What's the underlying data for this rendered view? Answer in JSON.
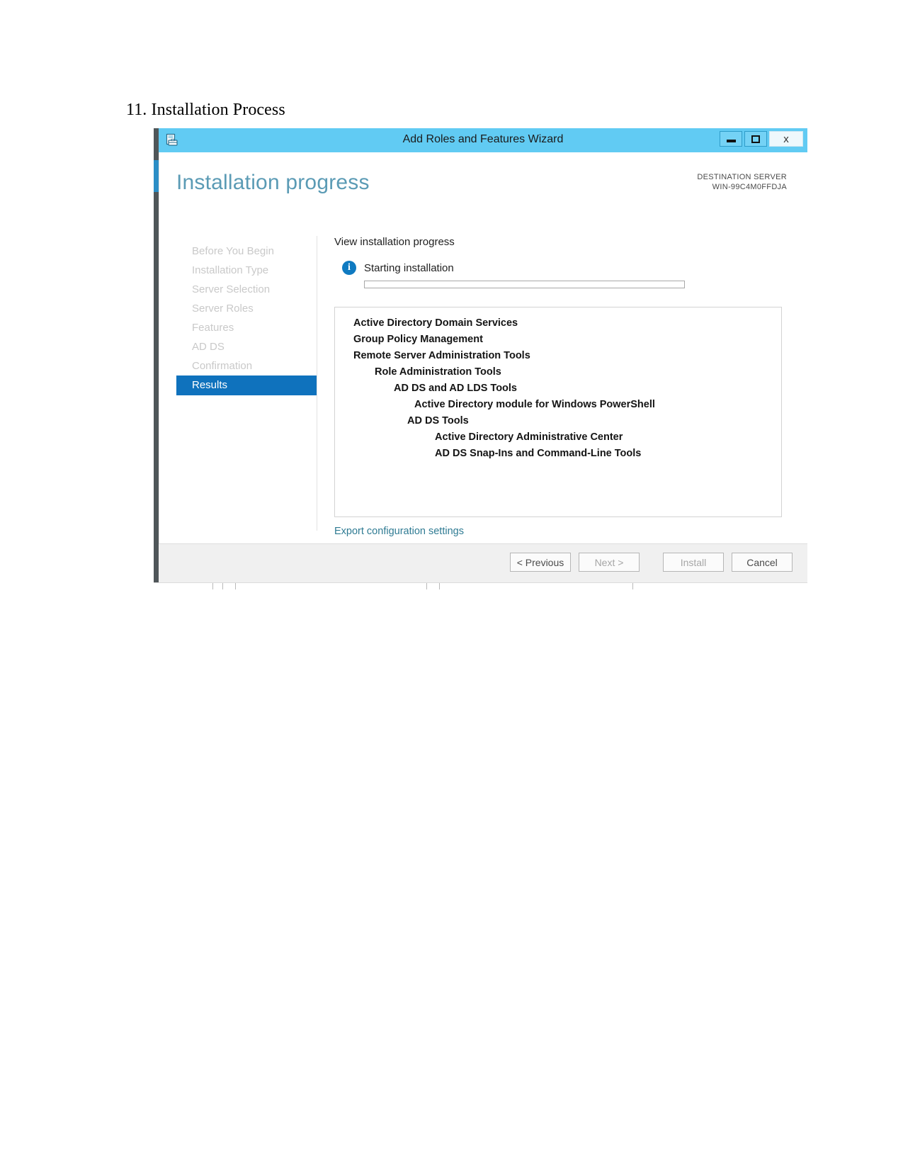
{
  "document": {
    "heading": "11. Installation Process"
  },
  "window": {
    "title": "Add Roles and Features Wizard",
    "icon": "wizard-window-icon",
    "controls": {
      "minimize": "minimize-icon",
      "maximize": "maximize-icon",
      "close": "x"
    }
  },
  "page": {
    "title": "Installation progress",
    "destination_server_label": "DESTINATION SERVER",
    "destination_server_name": "WIN-99C4M0FFDJA"
  },
  "nav": {
    "items": [
      {
        "label": "Before You Begin",
        "selected": false
      },
      {
        "label": "Installation Type",
        "selected": false
      },
      {
        "label": "Server Selection",
        "selected": false
      },
      {
        "label": "Server Roles",
        "selected": false
      },
      {
        "label": "Features",
        "selected": false
      },
      {
        "label": "AD DS",
        "selected": false
      },
      {
        "label": "Confirmation",
        "selected": false
      },
      {
        "label": "Results",
        "selected": true
      }
    ]
  },
  "main": {
    "section_label": "View installation progress",
    "status_icon": "info-icon",
    "status_text": "Starting installation",
    "progress_percent": 0,
    "features": [
      {
        "label": "Active Directory Domain Services",
        "indent": 0
      },
      {
        "label": "Group Policy Management",
        "indent": 0
      },
      {
        "label": "Remote Server Administration Tools",
        "indent": 0
      },
      {
        "label": "Role Administration Tools",
        "indent": 1
      },
      {
        "label": "AD DS and AD LDS Tools",
        "indent": 2
      },
      {
        "label": "Active Directory module for Windows PowerShell",
        "indent": 3
      },
      {
        "label": "AD DS Tools",
        "indent": 3
      },
      {
        "label": "Active Directory Administrative Center",
        "indent": 4
      },
      {
        "label": "AD DS Snap-Ins and Command-Line Tools",
        "indent": 4
      }
    ],
    "export_link": "Export configuration settings"
  },
  "footer": {
    "previous": "< Previous",
    "next": "Next >",
    "install": "Install",
    "cancel": "Cancel"
  },
  "colors": {
    "titlebar": "#61cbf3",
    "accent_blue": "#0f72bd",
    "heading_blue": "#5b9bb5",
    "link_teal": "#2f7b93"
  }
}
